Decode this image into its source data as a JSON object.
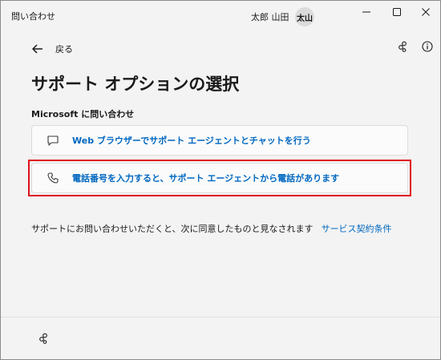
{
  "window": {
    "title": "問い合わせ",
    "user_name": "太郎 山田",
    "avatar_initials": "太山",
    "controls": [
      "minimize-icon",
      "maximize-icon",
      "close-icon"
    ]
  },
  "nav": {
    "back_label": "戻る",
    "top_right_icons": [
      "share-icon",
      "info-icon"
    ]
  },
  "page": {
    "title": "サポート オプションの選択",
    "section_label": "Microsoft に問い合わせ"
  },
  "options": [
    {
      "icon": "chat-icon",
      "label": "Web ブラウザーでサポート エージェントとチャットを行う"
    },
    {
      "icon": "phone-icon",
      "label": "電話番号を入力すると、サポート エージェントから電話があります"
    }
  ],
  "terms": {
    "text": "サポートにお問い合わせいただくと、次に同意したものと見なされます",
    "link": "サービス契約条件"
  },
  "colors": {
    "accent": "#0067c0",
    "highlight": "#e0101c",
    "background": "#f3f3f3"
  },
  "footer": {
    "icon": "share-icon"
  }
}
